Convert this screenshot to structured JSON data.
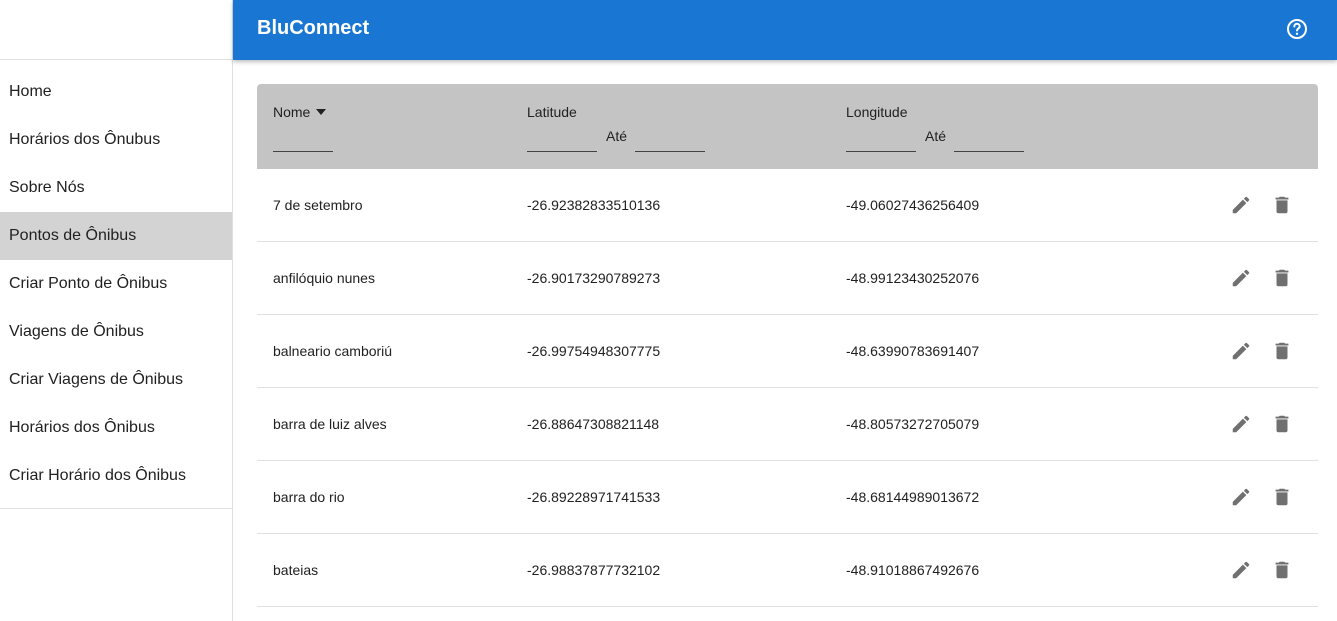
{
  "app": {
    "title": "BluConnect",
    "brand_color": "#1976d2",
    "help_icon": "help-circle-icon"
  },
  "sidebar": {
    "items": [
      {
        "label": "Home",
        "active": false
      },
      {
        "label": "Horários dos Ônubus",
        "active": false
      },
      {
        "label": "Sobre Nós",
        "active": false
      },
      {
        "label": "Pontos de Ônibus",
        "active": true
      },
      {
        "label": "Criar Ponto de Ônibus",
        "active": false
      },
      {
        "label": "Viagens de Ônibus",
        "active": false
      },
      {
        "label": "Criar Viagens de Ônibus",
        "active": false
      },
      {
        "label": "Horários dos Ônibus",
        "active": false
      },
      {
        "label": "Criar Horário dos Ônibus",
        "active": false
      }
    ]
  },
  "table": {
    "columns": {
      "name": {
        "label": "Nome",
        "sort": "desc",
        "filter_value": ""
      },
      "latitude": {
        "label": "Latitude",
        "range_label": "Até",
        "from_value": "",
        "to_value": ""
      },
      "longitude": {
        "label": "Longitude",
        "range_label": "Até",
        "from_value": "",
        "to_value": ""
      }
    },
    "rows": [
      {
        "name": "7 de setembro",
        "latitude": "-26.92382833510136",
        "longitude": "-49.06027436256409"
      },
      {
        "name": "anfilóquio nunes",
        "latitude": "-26.90173290789273",
        "longitude": "-48.99123430252076"
      },
      {
        "name": "balneario camboriú",
        "latitude": "-26.99754948307775",
        "longitude": "-48.63990783691407"
      },
      {
        "name": "barra de luiz alves",
        "latitude": "-26.88647308821148",
        "longitude": "-48.80573272705079"
      },
      {
        "name": "barra do rio",
        "latitude": "-26.89228971741533",
        "longitude": "-48.68144989013672"
      },
      {
        "name": "bateias",
        "latitude": "-26.98837877732102",
        "longitude": "-48.91018867492676"
      }
    ],
    "row_actions": [
      "pencil-icon",
      "trash-icon"
    ]
  }
}
